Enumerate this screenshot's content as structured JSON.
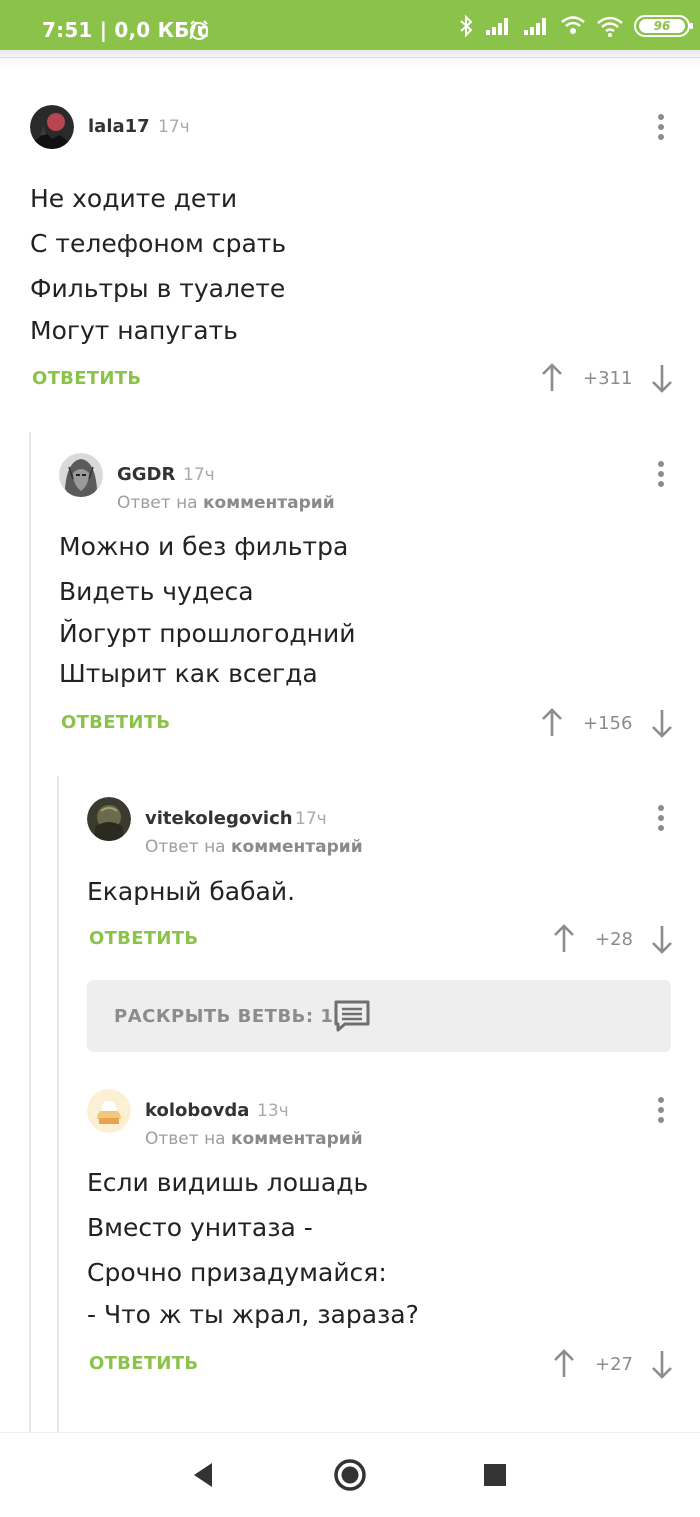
{
  "status_bar": {
    "time_speed": "7:51 | 0,0 КБ/с",
    "battery": "96"
  },
  "comments": [
    {
      "author": "lala17",
      "age": "17ч",
      "lines": [
        "Не ходите дети",
        "С телефоном срать",
        "Фильтры в туалете",
        "Могут напугать"
      ],
      "reply_label": "ОТВЕТИТЬ",
      "score": "+311"
    },
    {
      "author": "GGDR",
      "age": "17ч",
      "reply_to_prefix": "Ответ на",
      "reply_to_target": "комментарий",
      "lines": [
        "Можно и без фильтра",
        "Видеть чудеса",
        "Йогурт прошлогодний",
        "Штырит как всегда"
      ],
      "reply_label": "ОТВЕТИТЬ",
      "score": "+156"
    },
    {
      "author": "vitekolegovich",
      "age": "17ч",
      "reply_to_prefix": "Ответ на",
      "reply_to_target": "комментарий",
      "lines": [
        "Екарный бабай."
      ],
      "reply_label": "ОТВЕТИТЬ",
      "score": "+28"
    },
    {
      "author": "kolobovda",
      "age": "13ч",
      "reply_to_prefix": "Ответ на",
      "reply_to_target": "комментарий",
      "lines": [
        "Если видишь лошадь",
        "Вместо унитаза -",
        "Срочно призадумайся:",
        "- Что ж ты жрал, зараза?"
      ],
      "reply_label": "ОТВЕТИТЬ",
      "score": "+27"
    }
  ],
  "expand_branch": {
    "label": "РАСКРЫТЬ ВЕТВЬ: 1"
  },
  "colors": {
    "accent": "#8bc34a",
    "text": "#222222",
    "muted": "#9e9e9e"
  },
  "icons": [
    "bluetooth-icon",
    "signal-icon",
    "wifi-calling-icon",
    "wifi-icon",
    "alarm-icon",
    "more-vertical-icon",
    "arrow-up-icon",
    "arrow-down-icon",
    "comment-icon",
    "nav-back-icon",
    "nav-home-icon",
    "nav-recents-icon"
  ]
}
